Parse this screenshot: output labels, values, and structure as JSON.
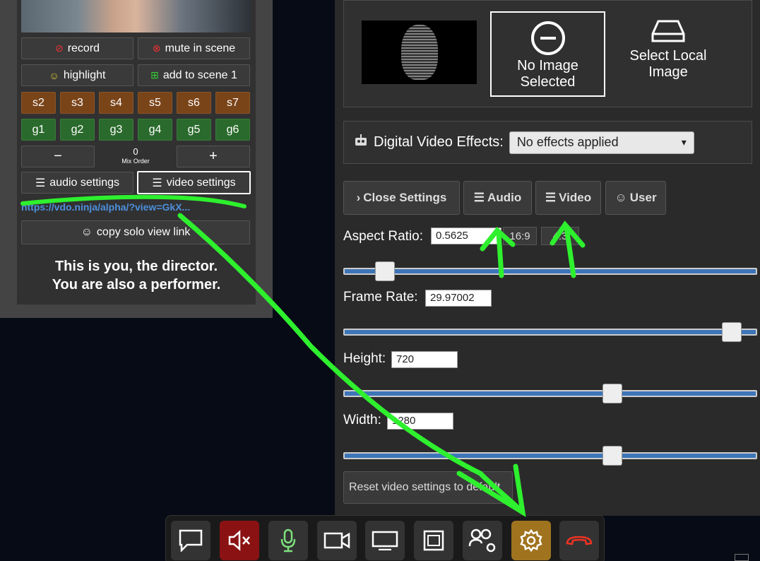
{
  "director": {
    "buttons": {
      "record": "record",
      "mute_in_scene": "mute in scene",
      "highlight": "highlight",
      "add_to_scene": "add to scene 1",
      "audio_settings": "audio settings",
      "video_settings": "video settings",
      "copy_solo": "copy solo view link"
    },
    "scenes": [
      "s2",
      "s3",
      "s4",
      "s5",
      "s6",
      "s7"
    ],
    "groups": [
      "g1",
      "g2",
      "g3",
      "g4",
      "g5",
      "g6"
    ],
    "mix_order": {
      "minus": "−",
      "value": "0",
      "label": "Mix Order",
      "plus": "+"
    },
    "solo_link": "https://vdo.ninja/alpha/?view=GkX...",
    "info_line1": "This is you, the director.",
    "info_line2": "You are also a performer."
  },
  "background_image": {
    "no_image_label": "No Image Selected",
    "select_local_label": "Select Local Image"
  },
  "effects": {
    "label": "Digital Video Effects:",
    "selected": "No effects applied"
  },
  "tabs": {
    "close": "Close Settings",
    "audio": "Audio",
    "video": "Video",
    "user": "User"
  },
  "video_settings": {
    "aspect_label": "Aspect Ratio:",
    "aspect_value": "0.5625",
    "aspect_preset_a": "16:9",
    "aspect_preset_b": "4:3",
    "aspect_slider": 0.1,
    "framerate_label": "Frame Rate:",
    "framerate_value": "29.97002",
    "framerate_slider": 0.938,
    "height_label": "Height:",
    "height_value": "720",
    "height_slider": 0.65,
    "width_label": "Width:",
    "width_value": "1280",
    "width_slider": 0.65,
    "reset_label": "Reset video settings to default"
  },
  "toolbar_icons": [
    "chat-icon",
    "speaker-mute-icon",
    "microphone-icon",
    "camera-icon",
    "screen-share-icon",
    "window-icon",
    "users-settings-icon",
    "gear-icon",
    "hangup-icon"
  ],
  "colors": {
    "accent_blue": "#3d75b8",
    "scene_brown": "#7a4419",
    "group_green": "#2a6a2c",
    "mute_red": "#8b1212",
    "settings_gold": "#a0731f",
    "annotation_green": "#2ef02e"
  }
}
